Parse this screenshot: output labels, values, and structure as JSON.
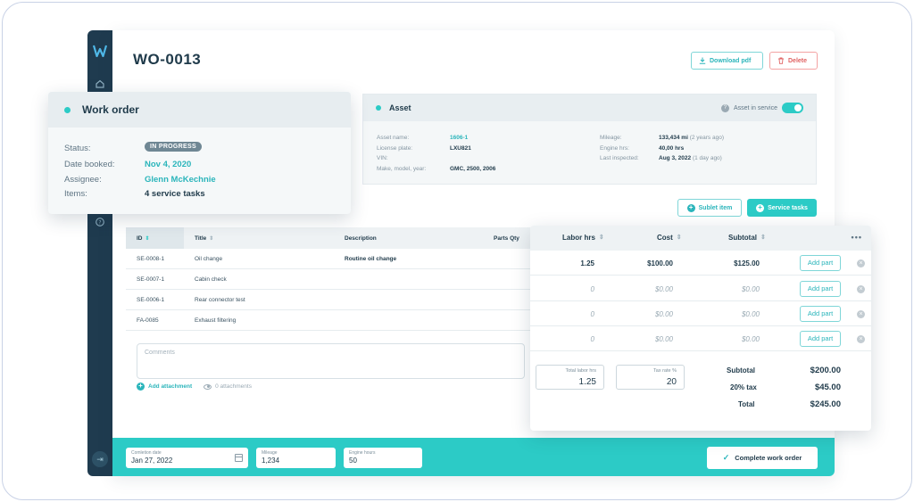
{
  "sidebar": {
    "logo": "logo-icon",
    "items": [
      "home-icon",
      "help-icon"
    ],
    "collapse": "collapse-icon"
  },
  "header": {
    "title": "WO-0013",
    "download_label": "Download pdf",
    "delete_label": "Delete"
  },
  "work_order": {
    "title": "Work order",
    "status_label": "Status:",
    "status_value": "IN PROGRESS",
    "date_label": "Date booked:",
    "date_value": "Nov 4, 2020",
    "assignee_label": "Assignee:",
    "assignee_value": "Glenn McKechnie",
    "items_label": "Items:",
    "items_value": "4 service tasks"
  },
  "asset": {
    "title": "Asset",
    "in_service_label": "Asset in service",
    "in_service": true,
    "name_label": "Asset name:",
    "name_value": "1606-1",
    "plate_label": "License plate:",
    "plate_value": "LXU821",
    "vin_label": "VIN:",
    "vin_value": "",
    "make_label": "Make, model, year:",
    "make_value": "GMC, 2500, 2006",
    "mileage_label": "Mileage:",
    "mileage_value": "133,434 mi",
    "mileage_note": "(2 years ago)",
    "engine_label": "Engine hrs:",
    "engine_value": "40,00 hrs",
    "inspected_label": "Last inspected:",
    "inspected_value": "Aug 3, 2022",
    "inspected_note": "(1 day ago)"
  },
  "actions": {
    "sublet_label": "Sublet item",
    "service_label": "Service tasks"
  },
  "tasks": {
    "columns": [
      "ID",
      "Title",
      "Description",
      "Parts Qty"
    ],
    "rows": [
      {
        "id": "SE-0008-1",
        "title": "Oil change",
        "description": "Routine oil change"
      },
      {
        "id": "SE-0007-1",
        "title": "Cabin check",
        "description": ""
      },
      {
        "id": "SE-0006-1",
        "title": "Rear connector test",
        "description": ""
      },
      {
        "id": "FA-0085",
        "title": "Exhaust filtering",
        "description": ""
      }
    ],
    "comments_placeholder": "Comments",
    "add_attachment": "Add attachment",
    "attachments": "0 attachments"
  },
  "costs": {
    "columns": [
      "Labor hrs",
      "Cost",
      "Subtotal"
    ],
    "add_part_label": "Add part",
    "rows": [
      {
        "labor": "1.25",
        "cost": "$100.00",
        "subtotal": "$125.00",
        "filled": true
      },
      {
        "labor": "0",
        "cost": "$0.00",
        "subtotal": "$0.00",
        "filled": false
      },
      {
        "labor": "0",
        "cost": "$0.00",
        "subtotal": "$0.00",
        "filled": false
      },
      {
        "labor": "0",
        "cost": "$0.00",
        "subtotal": "$0.00",
        "filled": false
      }
    ],
    "total_labor_label": "Total labor hrs",
    "total_labor_value": "1.25",
    "tax_rate_label": "Tax rate %",
    "tax_rate_value": "20",
    "subtotal_label": "Subtotal",
    "subtotal_value": "$200.00",
    "tax_label": "20% tax",
    "tax_value": "$45.00",
    "total_label": "Total",
    "total_value": "$245.00"
  },
  "bottom": {
    "completion_label": "Comletion date",
    "completion_value": "Jan 27, 2022",
    "mileage_label": "Mileage",
    "mileage_value": "1,234",
    "engine_label": "Engine hours",
    "engine_value": "50",
    "complete_label": "Complete work order"
  },
  "colors": {
    "accent": "#2ccbc6",
    "sidebar": "#1f3b4f",
    "danger": "#e06262"
  }
}
